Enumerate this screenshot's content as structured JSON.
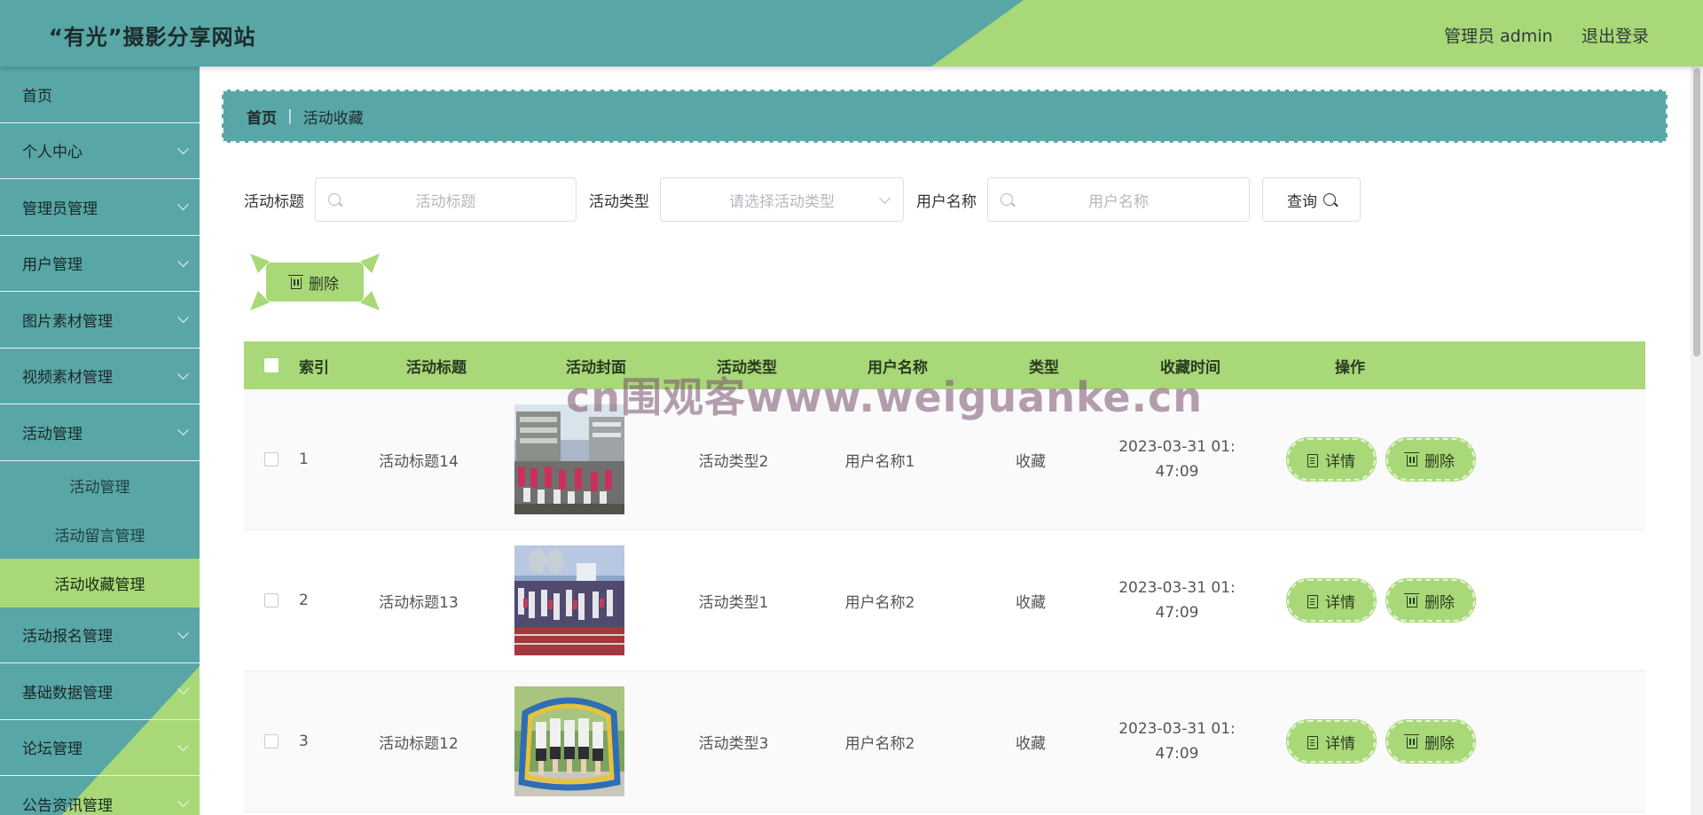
{
  "header": {
    "title": "“有光”摄影分享网站",
    "admin_label": "管理员 admin",
    "logout_label": "退出登录"
  },
  "sidebar": {
    "items": [
      {
        "label": "首页",
        "expandable": false
      },
      {
        "label": "个人中心",
        "expandable": true
      },
      {
        "label": "管理员管理",
        "expandable": true
      },
      {
        "label": "用户管理",
        "expandable": true
      },
      {
        "label": "图片素材管理",
        "expandable": true
      },
      {
        "label": "视频素材管理",
        "expandable": true
      },
      {
        "label": "活动管理",
        "expandable": true,
        "expanded": true,
        "children": [
          {
            "label": "活动管理",
            "active": false
          },
          {
            "label": "活动留言管理",
            "active": false
          },
          {
            "label": "活动收藏管理",
            "active": true
          }
        ]
      },
      {
        "label": "活动报名管理",
        "expandable": true
      },
      {
        "label": "基础数据管理",
        "expandable": true
      },
      {
        "label": "论坛管理",
        "expandable": true
      },
      {
        "label": "公告资讯管理",
        "expandable": true
      }
    ]
  },
  "breadcrumb": {
    "home": "首页",
    "separator": "|",
    "current": "活动收藏"
  },
  "search": {
    "title_label": "活动标题",
    "title_placeholder": "活动标题",
    "type_label": "活动类型",
    "type_placeholder": "请选择活动类型",
    "user_label": "用户名称",
    "user_placeholder": "用户名称",
    "query_label": "查询"
  },
  "toolbar": {
    "delete_label": "删除"
  },
  "table": {
    "columns": [
      "索引",
      "活动标题",
      "活动封面",
      "活动类型",
      "用户名称",
      "类型",
      "收藏时间",
      "操作"
    ],
    "rows": [
      {
        "index": "1",
        "title": "活动标题14",
        "type": "活动类型2",
        "user": "用户名称1",
        "kind": "收藏",
        "time": "2023-03-31 01:47:09"
      },
      {
        "index": "2",
        "title": "活动标题13",
        "type": "活动类型1",
        "user": "用户名称2",
        "kind": "收藏",
        "time": "2023-03-31 01:47:09"
      },
      {
        "index": "3",
        "title": "活动标题12",
        "type": "活动类型3",
        "user": "用户名称2",
        "kind": "收藏",
        "time": "2023-03-31 01:47:09"
      }
    ],
    "detail_label": "详情",
    "delete_label": "删除"
  },
  "watermark": "cn围观客www.weiguanke.cn",
  "colors": {
    "teal": "#58a6a6",
    "green": "#a8d878"
  }
}
